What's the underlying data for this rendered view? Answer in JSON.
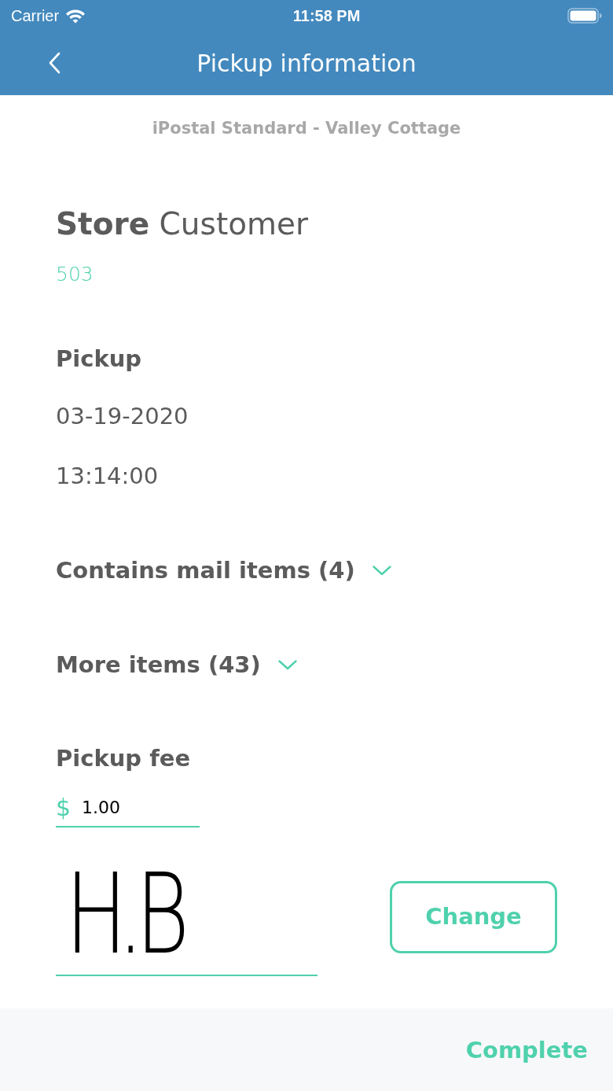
{
  "status_bar": {
    "carrier": "Carrier",
    "time": "11:58 PM"
  },
  "nav_bar": {
    "title": "Pickup information"
  },
  "location": "iPostal Standard - Valley Cottage",
  "customer": {
    "name": "**Store** Customer",
    "number": "503"
  },
  "pickup": {
    "heading": "Pickup",
    "date": "03-19-2020",
    "time": "13:14:00"
  },
  "sections": [
    {
      "label": "Contains mail items (4)",
      "expanded": false
    },
    {
      "label": "More items (43)",
      "expanded": false
    }
  ],
  "fee": {
    "label": "Pickup fee",
    "currency": "$",
    "value": "1.00"
  },
  "signature": {
    "value": "H.B",
    "button": "Change"
  },
  "footer": {
    "button": "Complete"
  }
}
